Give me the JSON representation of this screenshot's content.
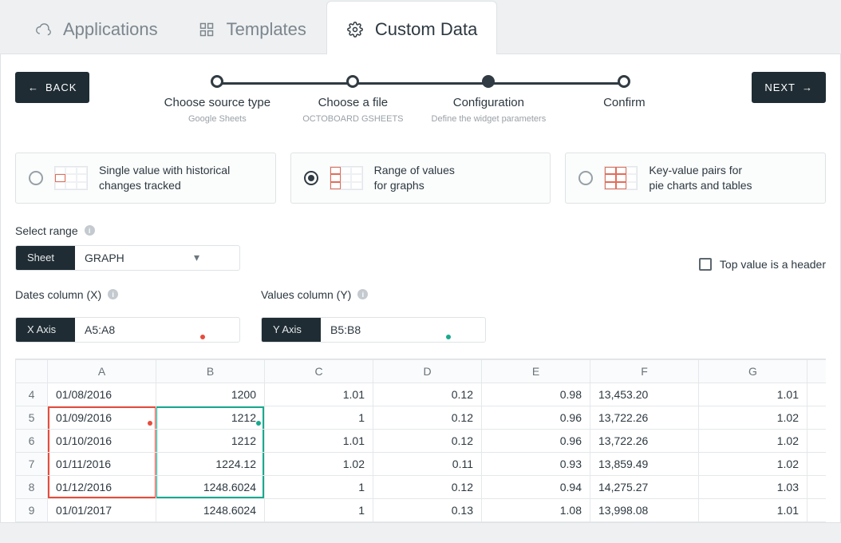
{
  "tabs": {
    "applications": "Applications",
    "templates": "Templates",
    "custom_data": "Custom Data"
  },
  "nav": {
    "back": "BACK",
    "next": "NEXT"
  },
  "stepper": [
    {
      "label": "Choose source type",
      "sub": "Google Sheets"
    },
    {
      "label": "Choose a file",
      "sub": "OCTOBOARD GSHEETS"
    },
    {
      "label": "Configuration",
      "sub": "Define the widget parameters"
    },
    {
      "label": "Confirm",
      "sub": ""
    }
  ],
  "options": {
    "single": {
      "line1": "Single value with historical",
      "line2": "changes tracked"
    },
    "range": {
      "line1": "Range of values",
      "line2": "for graphs"
    },
    "kv": {
      "line1": "Key-value pairs for",
      "line2": "pie charts and tables"
    }
  },
  "form": {
    "select_range": "Select range",
    "sheet_label": "Sheet",
    "sheet_value": "GRAPH",
    "header_checkbox": "Top value is a header",
    "dates_label": "Dates column (X)",
    "values_label": "Values column (Y)",
    "x_label": "X Axis",
    "x_value": "A5:A8",
    "y_label": "Y Axis",
    "y_value": "B5:B8"
  },
  "sheet": {
    "cols": [
      "A",
      "B",
      "C",
      "D",
      "E",
      "F",
      "G"
    ],
    "rows": [
      {
        "n": 4,
        "a": "01/08/2016",
        "b": "1200",
        "c": "1.01",
        "d": "0.12",
        "e": "0.98",
        "f": "13,453.20",
        "g": "1.01"
      },
      {
        "n": 5,
        "a": "01/09/2016",
        "b": "1212",
        "c": "1",
        "d": "0.12",
        "e": "0.96",
        "f": "13,722.26",
        "g": "1.02"
      },
      {
        "n": 6,
        "a": "01/10/2016",
        "b": "1212",
        "c": "1.01",
        "d": "0.12",
        "e": "0.96",
        "f": "13,722.26",
        "g": "1.02"
      },
      {
        "n": 7,
        "a": "01/11/2016",
        "b": "1224.12",
        "c": "1.02",
        "d": "0.11",
        "e": "0.93",
        "f": "13,859.49",
        "g": "1.02"
      },
      {
        "n": 8,
        "a": "01/12/2016",
        "b": "1248.6024",
        "c": "1",
        "d": "0.12",
        "e": "0.94",
        "f": "14,275.27",
        "g": "1.03"
      },
      {
        "n": 9,
        "a": "01/01/2017",
        "b": "1248.6024",
        "c": "1",
        "d": "0.13",
        "e": "1.08",
        "f": "13,998.08",
        "g": "1.01"
      }
    ]
  }
}
